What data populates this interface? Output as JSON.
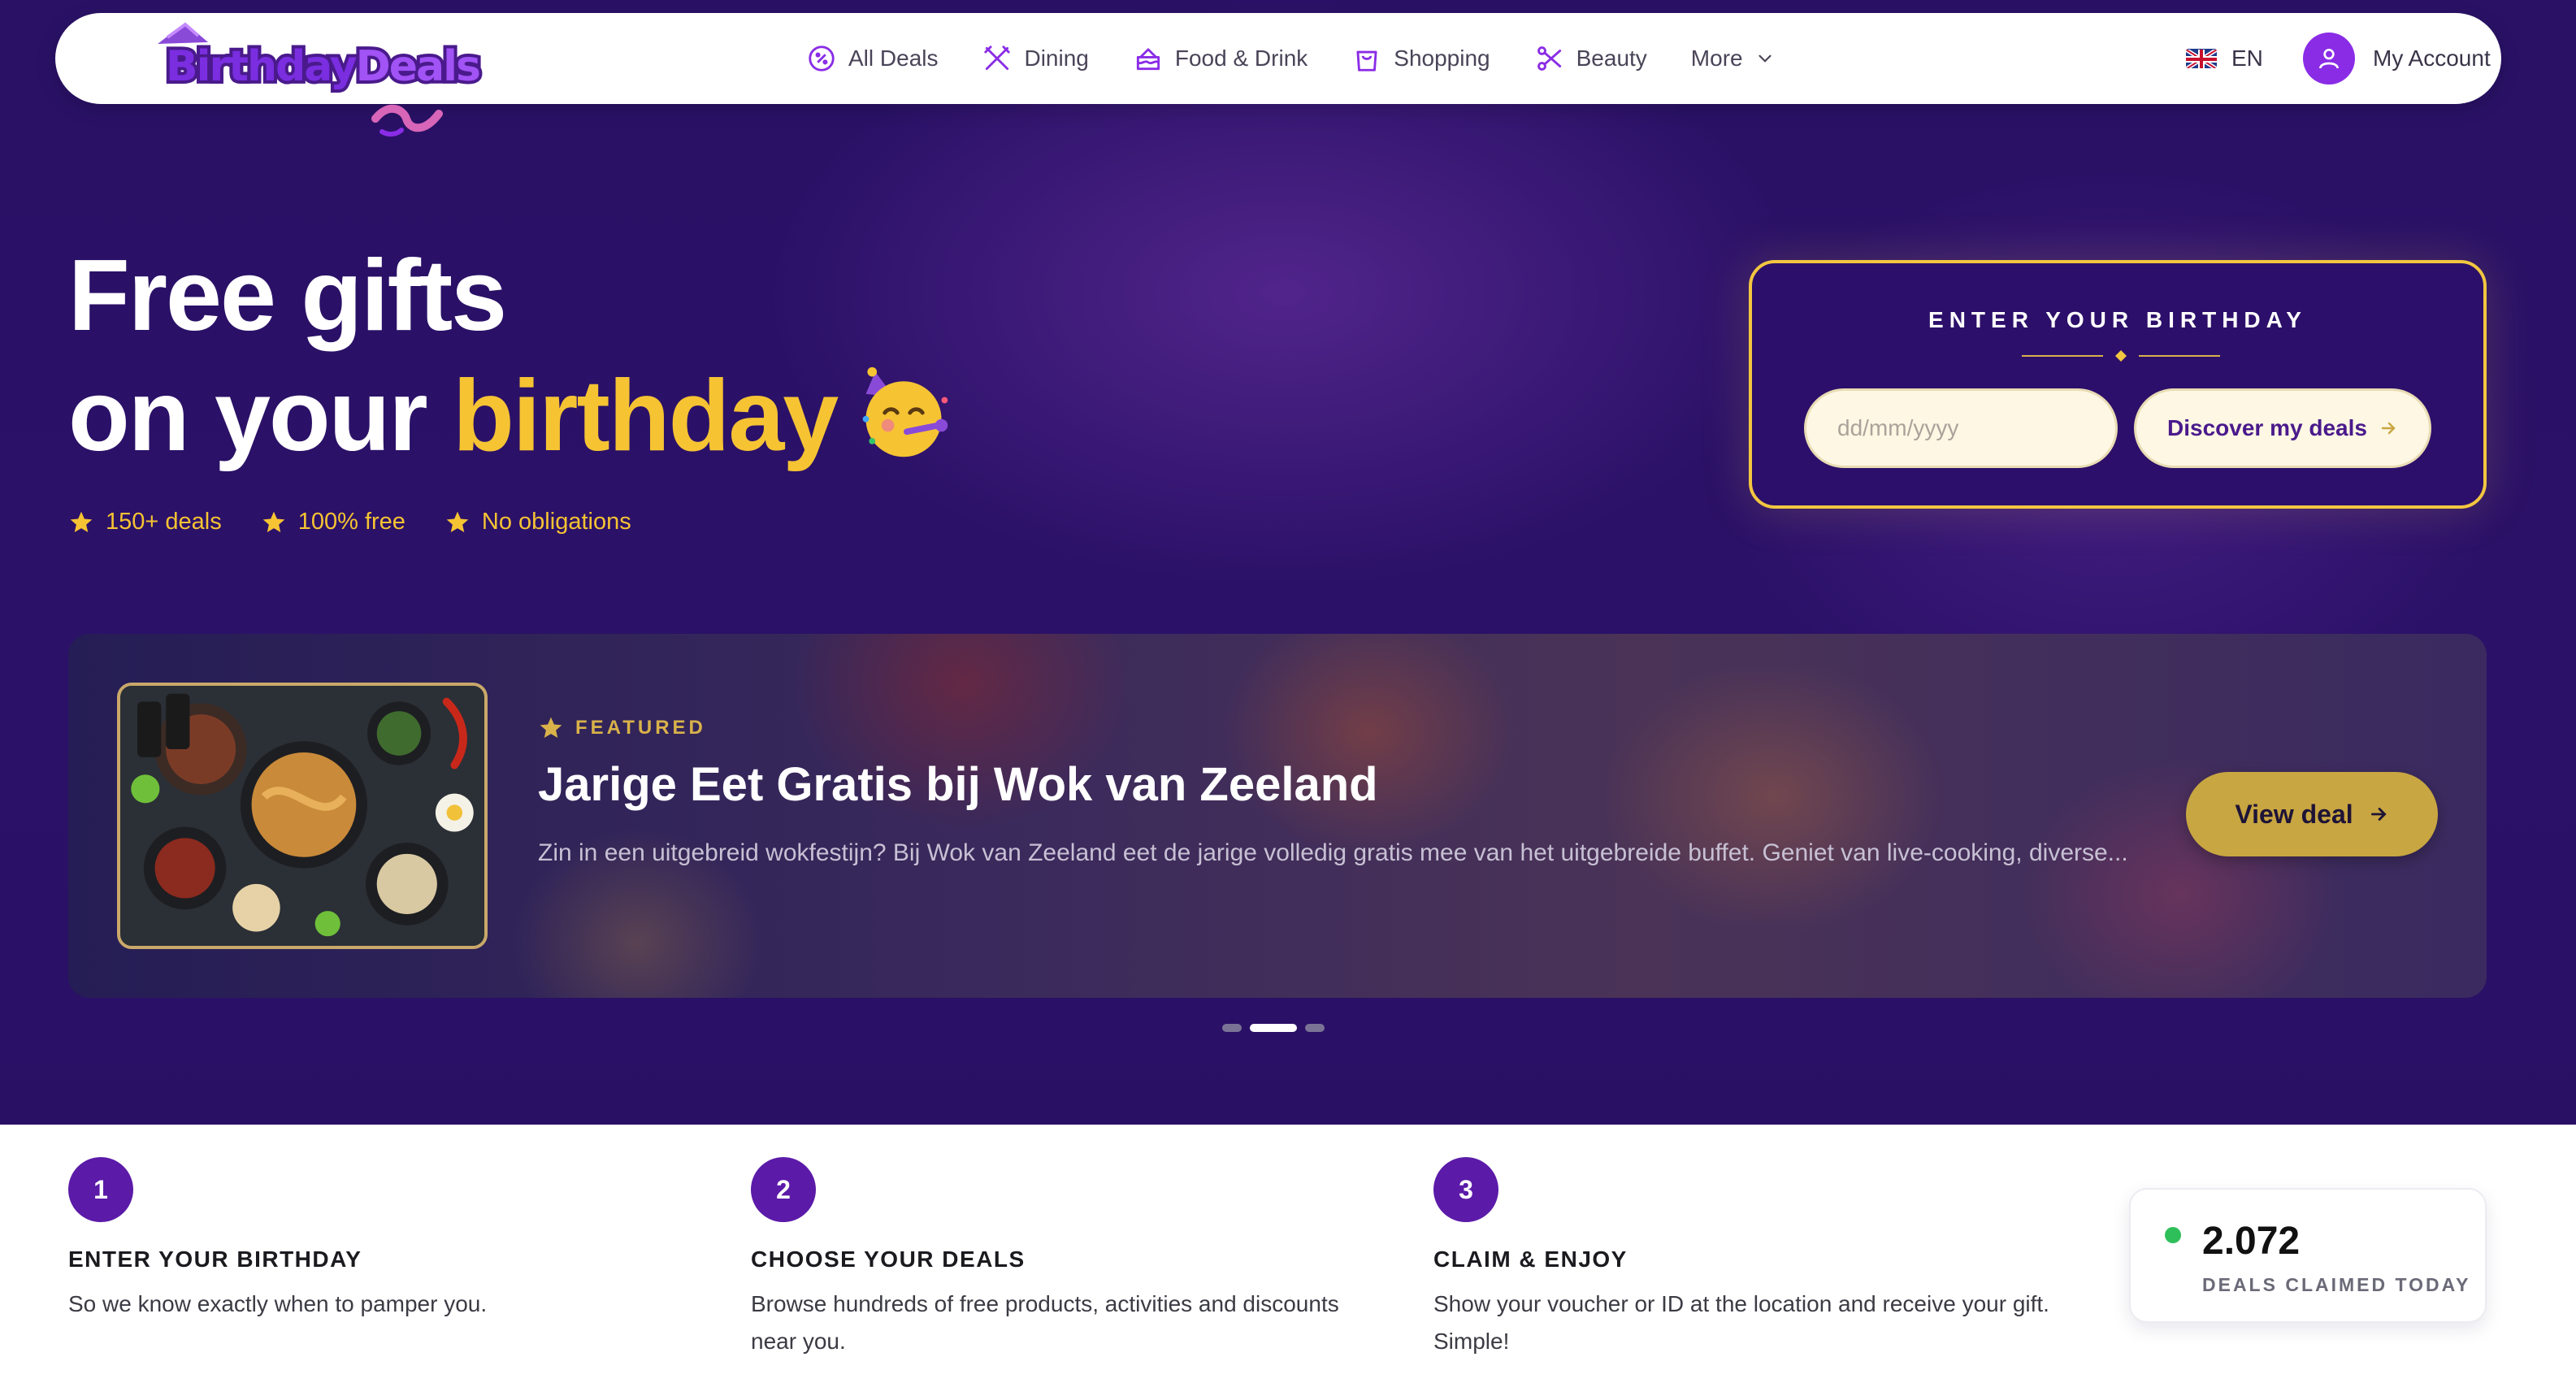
{
  "brand": {
    "name": "BirthdayDeals",
    "name_part1": "Birthday",
    "name_part2": "Deals"
  },
  "nav": {
    "items": [
      {
        "label": "All Deals",
        "icon": "badge-percent-icon"
      },
      {
        "label": "Dining",
        "icon": "fork-knife-icon"
      },
      {
        "label": "Food & Drink",
        "icon": "cake-icon"
      },
      {
        "label": "Shopping",
        "icon": "shopping-bag-icon"
      },
      {
        "label": "Beauty",
        "icon": "scissors-icon"
      },
      {
        "label": "More",
        "icon": "chevron-down-icon"
      }
    ],
    "language": "EN",
    "account_label": "My Account"
  },
  "hero": {
    "title_line1": "Free gifts",
    "title_line2_prefix": "on your ",
    "title_line2_highlight": "birthday",
    "badges": [
      "150+ deals",
      "100% free",
      "No obligations"
    ]
  },
  "birthday_form": {
    "heading": "ENTER YOUR BIRTHDAY",
    "input_placeholder": "dd/mm/yyyy",
    "input_value": "",
    "button_label": "Discover my deals"
  },
  "featured": {
    "label": "FEATURED",
    "title": "Jarige Eet Gratis bij Wok van Zeeland",
    "description": "Zin in een uitgebreid wokfestijn? Bij Wok van Zeeland eet de jarige volledig gratis mee van het uitgebreide buffet. Geniet van live-cooking, diverse...",
    "button_label": "View deal",
    "slides_total": 3,
    "slide_active": 2
  },
  "steps": [
    {
      "number": "1",
      "title": "ENTER YOUR BIRTHDAY",
      "description": "So we know exactly when to pamper you."
    },
    {
      "number": "2",
      "title": "CHOOSE YOUR DEALS",
      "description": "Browse hundreds of free products, activities and discounts near you."
    },
    {
      "number": "3",
      "title": "CLAIM & ENJOY",
      "description": "Show your voucher or ID at the location and receive your gift. Simple!"
    }
  ],
  "stats": {
    "value": "2.072",
    "label": "DEALS CLAIMED TODAY"
  },
  "colors": {
    "hero_bg": "#2a1166",
    "accent_gold": "#f6c333",
    "brand_purple": "#8a2ce6",
    "step_purple": "#5b1aa8",
    "status_green": "#2fbf5a"
  }
}
